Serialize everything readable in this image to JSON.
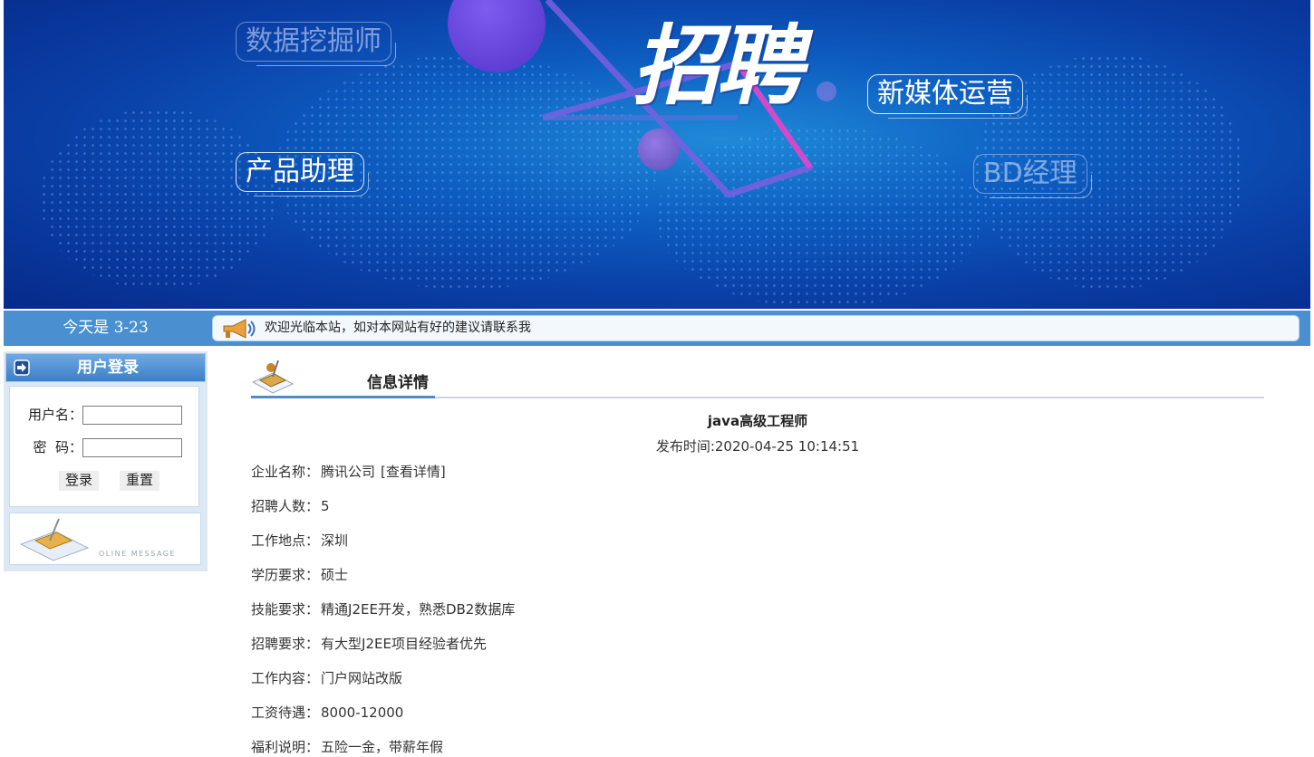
{
  "banner": {
    "title": "招聘",
    "tags": [
      "数据挖掘师",
      "新媒体运营",
      "产品助理",
      "BD经理"
    ]
  },
  "infobar": {
    "date": "今天是 3-23",
    "notice": "欢迎光临本站，如对本网站有好的建议请联系我"
  },
  "login": {
    "title": "用户登录",
    "username_label": "用户名：",
    "password_label": "密  码：",
    "login_button": "登录",
    "reset_button": "重置",
    "footer_text": "OLINE MESSAGE"
  },
  "detail": {
    "section_title": "信息详情",
    "job_title": "java高级工程师",
    "publish_time": "发布时间:2020-04-25 10:14:51",
    "company_label": "企业名称：",
    "company": "腾讯公司",
    "company_link": "[查看详情]",
    "fields": [
      {
        "label": "招聘人数：",
        "value": "5"
      },
      {
        "label": "工作地点：",
        "value": "深圳"
      },
      {
        "label": "学历要求：",
        "value": "硕士"
      },
      {
        "label": "技能要求：",
        "value": "精通J2EE开发，熟悉DB2数据库"
      },
      {
        "label": "招聘要求：",
        "value": "有大型J2EE项目经验者优先"
      },
      {
        "label": "工作内容：",
        "value": "门户网站改版"
      },
      {
        "label": "工资待遇：",
        "value": "8000-12000"
      },
      {
        "label": "福利说明：",
        "value": "五险一金，带薪年假"
      }
    ]
  }
}
